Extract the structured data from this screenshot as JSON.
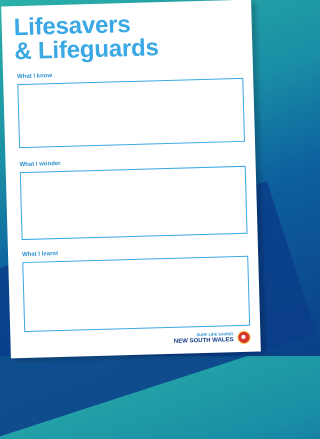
{
  "worksheet": {
    "title_line1": "Lifesavers",
    "title_line2": "& Lifeguards",
    "sections": [
      {
        "label": "What I know"
      },
      {
        "label": "What I wonder"
      },
      {
        "label": "What I learnt"
      }
    ],
    "footer": {
      "org_line1": "SURF LIFE SAVING",
      "org_line2": "NEW SOUTH WALES"
    }
  },
  "colors": {
    "accent": "#3aa8e4",
    "navy": "#143c8a",
    "background": "#1a8fa6"
  },
  "icons": {
    "logo": "surf-life-saving-emblem"
  }
}
